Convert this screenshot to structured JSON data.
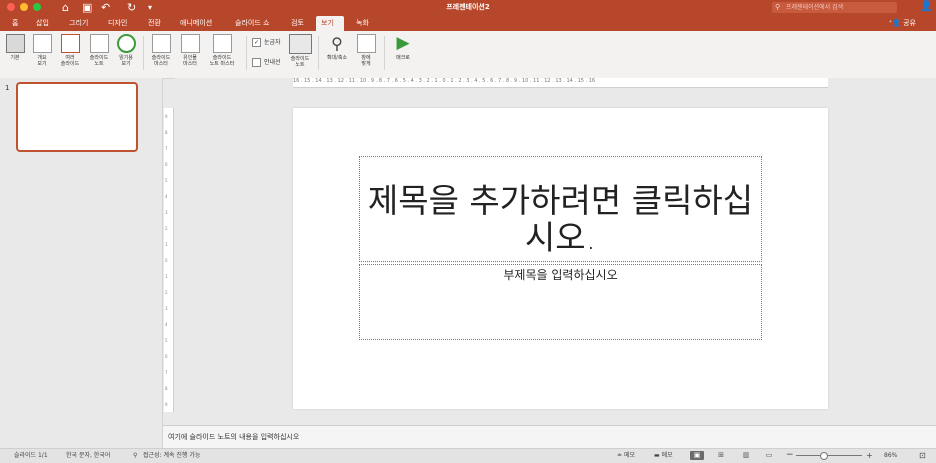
{
  "window": {
    "title": "프레젠테이션2",
    "search_placeholder": "프레젠테이션에서 검색",
    "quick_access": [
      "home-icon",
      "save-icon",
      "undo-icon",
      "redo-icon",
      "customize-icon"
    ]
  },
  "tabs": [
    {
      "label": "홈"
    },
    {
      "label": "삽입"
    },
    {
      "label": "그리기"
    },
    {
      "label": "디자인"
    },
    {
      "label": "전환"
    },
    {
      "label": "애니메이션"
    },
    {
      "label": "슬라이드 쇼"
    },
    {
      "label": "검토"
    },
    {
      "label": "보기",
      "active": true
    },
    {
      "label": "녹화"
    }
  ],
  "share_label": "공유",
  "ribbon": {
    "view_buttons": [
      {
        "label": "기본",
        "selected": true
      },
      {
        "label": "개요\n보기"
      },
      {
        "label": "여러\n슬라이드"
      },
      {
        "label": "슬라이드\n노트"
      },
      {
        "label": "읽기용\n보기"
      }
    ],
    "master_buttons": [
      {
        "label": "슬라이드\n마스터"
      },
      {
        "label": "유인물\n마스터"
      },
      {
        "label": "슬라이드\n노트 마스터"
      }
    ],
    "ruler_label": "눈금자",
    "ruler_checked": true,
    "guides_label": "안내선",
    "guides_checked": false,
    "notes_button": "슬라이드\n노트",
    "zoom_button": "확대/축소",
    "fit_button": "창에\n맞게",
    "macro_button": "매크로"
  },
  "thumbnails": [
    {
      "number": "1"
    }
  ],
  "ruler_labels": "16 . 15 . 14 . 13 . 12 . 11 . 10 . 9 . 8 . 7 . 6 . 5 . 4 . 3 . 2 . 1 . 0 . 1 . 2 . 3 . 4 . 5 . 6 . 7 . 8 . 9 . 10 . 11 . 12 . 13 . 14 . 15 . 16",
  "vruler_labels": [
    "9",
    "8",
    "7",
    "6",
    "5",
    "4",
    "3",
    "2",
    "1",
    "0",
    "1",
    "2",
    "3",
    "4",
    "5",
    "6",
    "7",
    "8",
    "9"
  ],
  "slide": {
    "title_placeholder": "제목을 추가하려면 클릭하십시오.",
    "subtitle_placeholder": "부제목을 입력하십시오"
  },
  "notes_placeholder": "여기에 슬라이드 노트의 내용을 입력하십시오",
  "status": {
    "slide_counter": "슬라이드 1/1",
    "language": "한국 문자, 한국어",
    "accessibility": "접근성: 계속 진행 가능",
    "notes_toggle": "메모",
    "comments_toggle": "메모",
    "zoom_value": 86,
    "zoom_label": "86%"
  }
}
